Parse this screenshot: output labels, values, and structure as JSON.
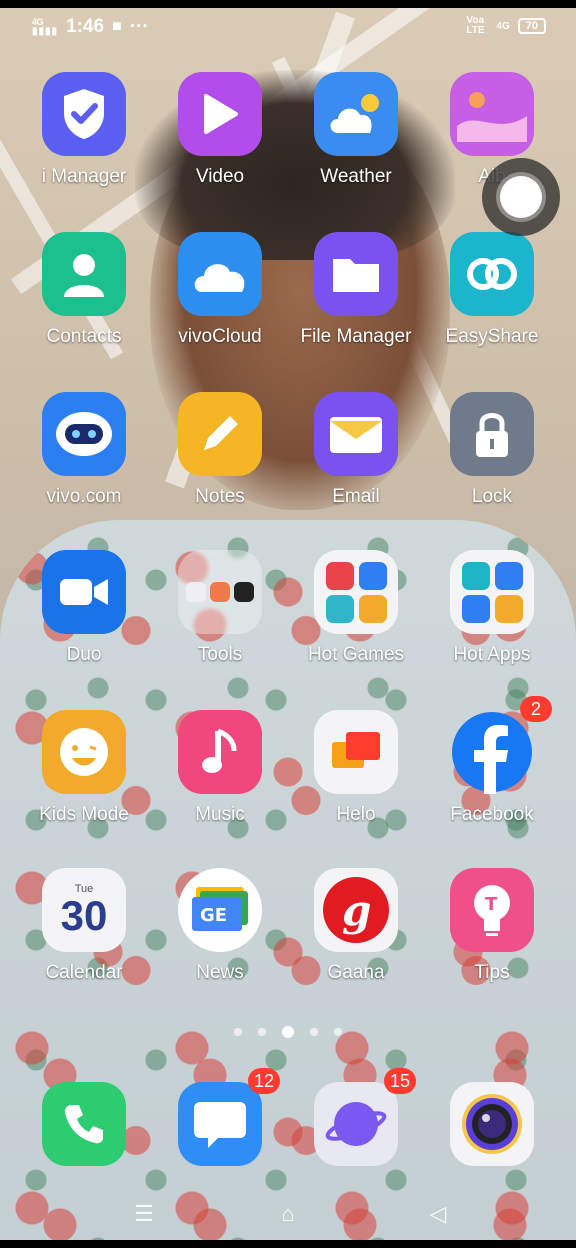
{
  "status_bar": {
    "time": "1:46",
    "network_left": "4G",
    "notification_dots": "···",
    "carrier": "Voa LTE",
    "network_right": "4G",
    "battery": "70"
  },
  "apps": [
    {
      "label": "i Manager",
      "icon": "shield-check-icon",
      "color": "#5b5ff1"
    },
    {
      "label": "Video",
      "icon": "play-icon",
      "color": "#b14dea"
    },
    {
      "label": "Weather",
      "icon": "cloud-sun-icon",
      "color": "#3b8cf0"
    },
    {
      "label": "Alb",
      "icon": "album-icon",
      "color": "#c65ee6"
    },
    {
      "label": "Contacts",
      "icon": "person-icon",
      "color": "#1cbf8e"
    },
    {
      "label": "vivoCloud",
      "icon": "cloud-icon",
      "color": "#2c8ff0"
    },
    {
      "label": "File Manager",
      "icon": "folder-icon",
      "color": "#7a52f0"
    },
    {
      "label": "EasyShare",
      "icon": "link-rings-icon",
      "color": "#1bb5cc"
    },
    {
      "label": "vivo.com",
      "icon": "robot-icon",
      "color": "#2b7ff0"
    },
    {
      "label": "Notes",
      "icon": "pencil-icon",
      "color": "#f6b524"
    },
    {
      "label": "Email",
      "icon": "envelope-icon",
      "color": "#7a52f0"
    },
    {
      "label": "Lock",
      "icon": "lock-icon",
      "color": "#6f7a8a"
    },
    {
      "label": "Duo",
      "icon": "video-camera-icon",
      "color": "#1a73e8"
    },
    {
      "label": "Tools",
      "icon": "folder-tools-icon",
      "color": "rgba(255,255,255,0.35)"
    },
    {
      "label": "Hot Games",
      "icon": "folder-games-icon",
      "color": "#f4f4f6"
    },
    {
      "label": "Hot Apps",
      "icon": "folder-apps-icon",
      "color": "#f4f4f6"
    },
    {
      "label": "Kids Mode",
      "icon": "kid-face-icon",
      "color": "#f3a92b"
    },
    {
      "label": "Music",
      "icon": "music-note-icon",
      "color": "#f0477f"
    },
    {
      "label": "Helo",
      "icon": "chat-bubbles-icon",
      "color": "#f4f4f6"
    },
    {
      "label": "Facebook",
      "icon": "facebook-icon",
      "color": "#1877f2",
      "badge": "2"
    },
    {
      "label": "Calendar",
      "icon": "calendar-icon",
      "color": "#f4f4f6",
      "day": "Tue",
      "date": "30"
    },
    {
      "label": "News",
      "icon": "google-news-icon",
      "color": "#ffffff"
    },
    {
      "label": "Gaana",
      "icon": "gaana-icon",
      "color": "#f4f4f6"
    },
    {
      "label": "Tips",
      "icon": "lightbulb-icon",
      "color": "#f0508a"
    }
  ],
  "dock": [
    {
      "name": "phone",
      "icon": "phone-icon",
      "color": "#2ecc71"
    },
    {
      "name": "messages",
      "icon": "message-icon",
      "color": "#2f8ef5",
      "badge": "12"
    },
    {
      "name": "browser",
      "icon": "planet-icon",
      "color": "#e8e8f2",
      "badge": "15"
    },
    {
      "name": "camera",
      "icon": "camera-lens-icon",
      "color": "#f4f4f6"
    }
  ],
  "page_indicator": {
    "pages": 5,
    "active": 2
  }
}
